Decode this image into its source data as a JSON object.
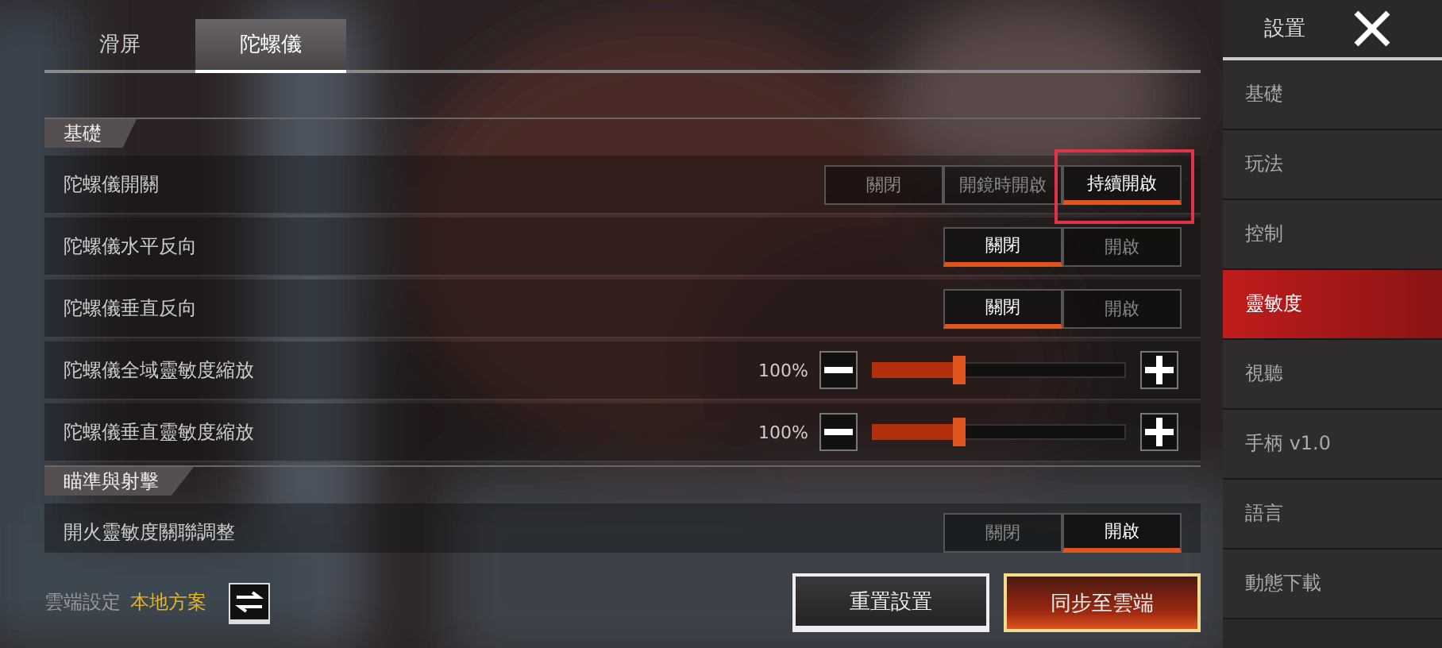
{
  "tabs": [
    {
      "label": "滑屏",
      "selected": false
    },
    {
      "label": "陀螺儀",
      "selected": true
    }
  ],
  "sections": [
    {
      "title": "基礎",
      "rows": [
        {
          "kind": "segmented",
          "label": "陀螺儀開關",
          "options": [
            {
              "label": "關閉",
              "selected": false,
              "highlighted": false
            },
            {
              "label": "開鏡時開啟",
              "selected": false,
              "highlighted": false
            },
            {
              "label": "持續開啟",
              "selected": true,
              "highlighted": true
            }
          ]
        },
        {
          "kind": "segmented",
          "label": "陀螺儀水平反向",
          "options": [
            {
              "label": "關閉",
              "selected": true,
              "highlighted": false
            },
            {
              "label": "開啟",
              "selected": false,
              "highlighted": false
            }
          ]
        },
        {
          "kind": "segmented",
          "label": "陀螺儀垂直反向",
          "options": [
            {
              "label": "關閉",
              "selected": true,
              "highlighted": false
            },
            {
              "label": "開啟",
              "selected": false,
              "highlighted": false
            }
          ]
        },
        {
          "kind": "slider",
          "label": "陀螺儀全域靈敏度縮放",
          "reading": "100%",
          "level": 0.32
        },
        {
          "kind": "slider",
          "label": "陀螺儀垂直靈敏度縮放",
          "reading": "100%",
          "level": 0.32
        }
      ]
    },
    {
      "title": "瞄準與射擊",
      "rows": [
        {
          "kind": "segmented",
          "label": "開火靈敏度關聯調整",
          "options": [
            {
              "label": "關閉",
              "selected": false,
              "highlighted": false
            },
            {
              "label": "開啟",
              "selected": true,
              "highlighted": false
            }
          ]
        }
      ]
    }
  ],
  "cloud": {
    "label": "雲端設定",
    "value": "本地方案"
  },
  "buttons": [
    {
      "label": "重置設置",
      "kind": "secondary"
    },
    {
      "label": "同步至雲端",
      "kind": "primary"
    }
  ],
  "sidebar": {
    "title": "設置",
    "items": [
      {
        "label": "基礎",
        "selected": false
      },
      {
        "label": "玩法",
        "selected": false
      },
      {
        "label": "控制",
        "selected": false
      },
      {
        "label": "靈敏度",
        "selected": true
      },
      {
        "label": "視聽",
        "selected": false
      },
      {
        "label": "手柄 v1.0",
        "selected": false
      },
      {
        "label": "語言",
        "selected": false
      },
      {
        "label": "動態下載",
        "selected": false
      }
    ]
  }
}
